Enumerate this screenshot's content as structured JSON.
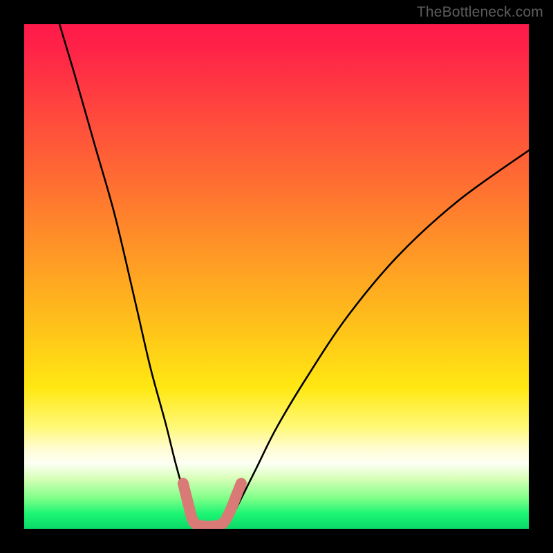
{
  "watermark": {
    "text": "TheBottleneck.com"
  },
  "chart_data": {
    "type": "line",
    "title": "",
    "subtitle": "",
    "xlabel": "",
    "ylabel": "",
    "xlim": [
      0,
      100
    ],
    "ylim": [
      0,
      100
    ],
    "grid": false,
    "legend": false,
    "series": [
      {
        "name": "left-branch",
        "x": [
          7,
          10,
          14,
          18,
          22,
          25,
          28,
          30,
          32,
          33.5,
          34.5
        ],
        "y": [
          100,
          90,
          76,
          62,
          45,
          32,
          21,
          13,
          6,
          2,
          0.5
        ]
      },
      {
        "name": "right-branch",
        "x": [
          40,
          41,
          43,
          46,
          50,
          56,
          64,
          74,
          86,
          100
        ],
        "y": [
          0.5,
          2,
          6,
          12,
          20,
          30,
          42,
          54,
          65,
          75
        ]
      }
    ],
    "bottom_segment": {
      "name": "flat-bottom",
      "x_start": 34.5,
      "x_end": 40,
      "y": 0.5
    },
    "markers": {
      "name": "dotted-bottom",
      "color": "#d97a76",
      "points": [
        {
          "x": 31.5,
          "y": 9
        },
        {
          "x": 32.5,
          "y": 5
        },
        {
          "x": 33.5,
          "y": 1.5
        },
        {
          "x": 35,
          "y": 0.6
        },
        {
          "x": 36.5,
          "y": 0.5
        },
        {
          "x": 38,
          "y": 0.6
        },
        {
          "x": 39.5,
          "y": 1.2
        },
        {
          "x": 40.8,
          "y": 3.5
        },
        {
          "x": 42,
          "y": 6.5
        },
        {
          "x": 43,
          "y": 9
        }
      ]
    },
    "gradient_stops": [
      {
        "pos": 0,
        "color": "#ff1a4b"
      },
      {
        "pos": 15,
        "color": "#ff4040"
      },
      {
        "pos": 45,
        "color": "#ff9626"
      },
      {
        "pos": 72,
        "color": "#ffe812"
      },
      {
        "pos": 90,
        "color": "#d8ffb8"
      },
      {
        "pos": 100,
        "color": "#0bd968"
      }
    ]
  }
}
